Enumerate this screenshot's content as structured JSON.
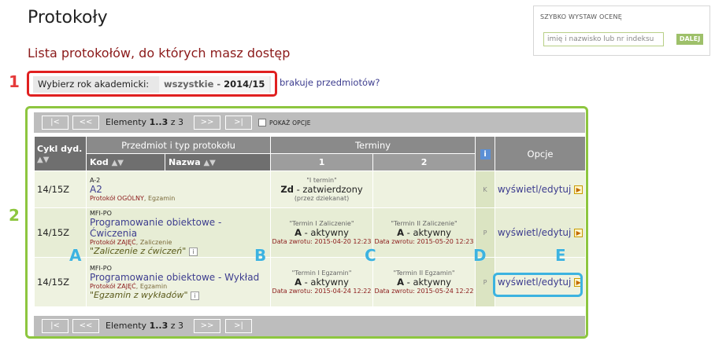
{
  "page": {
    "title": "Protokoły",
    "subtitle": "Lista protokołów, do których masz dostęp"
  },
  "quick_grade": {
    "title": "SZYBKO WYSTAW OCENĘ",
    "placeholder": "imię i nazwisko lub nr indeksu",
    "button": "DALEJ"
  },
  "year_filter": {
    "label": "Wybierz rok akademicki:",
    "value_all": "wszystkie",
    "value_sep": " - ",
    "value_year": "2014/15",
    "missing_link": "brakuje przedmiotów?"
  },
  "annotations": {
    "n1": "1",
    "n2": "2",
    "letters": [
      "A",
      "B",
      "C",
      "D",
      "E"
    ]
  },
  "pager": {
    "first": "|<",
    "prev": "<<",
    "next": ">>",
    "last": ">|",
    "text_prefix": "Elementy ",
    "range": "1..3",
    "text_suffix": " z 3",
    "show_options": "POKAŻ OPCJE"
  },
  "table": {
    "col_cycle": "Cykl dyd.",
    "col_subject": "Przedmiot i typ protokołu",
    "col_code": "Kod",
    "col_name": "Nazwa",
    "col_terms": "Terminy",
    "col_term1": "1",
    "col_term2": "2",
    "col_info": "i",
    "col_options": "Opcje",
    "rows": [
      {
        "cycle": "14/15Z",
        "code": "A-2",
        "subject": "A2",
        "protocol_kind": "Protokół OGÓLNY",
        "protocol_type": ", Egzamin",
        "note": "",
        "t1_name": "\"I termin\"",
        "t1_status_bold": "Zd",
        "t1_status": " - zatwierdzony",
        "t1_extra": "(przez dziekanat)",
        "t2_name": "",
        "t2_status_bold": "",
        "t2_status": "",
        "t2_date": "",
        "flag": "K",
        "action": "wyświetl/edytuj"
      },
      {
        "cycle": "14/15Z",
        "code": "MFI-PO",
        "subject": "Programowanie obiektowe - Ćwiczenia",
        "protocol_kind": "Protokół ZAJĘĆ",
        "protocol_type": ", Zaliczenie",
        "note": "\"Zaliczenie z ćwiczeń\"",
        "t1_name": "\"Termin I Zaliczenie\"",
        "t1_status_bold": "A",
        "t1_status": " - aktywny",
        "t1_date": "Data zwrotu: 2015-04-20 12:23",
        "t2_name": "\"Termin II Zaliczenie\"",
        "t2_status_bold": "A",
        "t2_status": " - aktywny",
        "t2_date": "Data zwrotu: 2015-05-20 12:23",
        "flag": "P",
        "action": "wyświetl/edytuj"
      },
      {
        "cycle": "14/15Z",
        "code": "MFI-PO",
        "subject": "Programowanie obiektowe - Wykład",
        "protocol_kind": "Protokół ZAJĘĆ",
        "protocol_type": ", Egzamin",
        "note": "\"Egzamin z wykładów\"",
        "t1_name": "\"Termin I Egzamin\"",
        "t1_status_bold": "A",
        "t1_status": " - aktywny",
        "t1_date": "Data zwrotu: 2015-04-24 12:22",
        "t2_name": "\"Termin II Egzamin\"",
        "t2_status_bold": "A",
        "t2_status": " - aktywny",
        "t2_date": "Data zwrotu: 2015-05-24 12:22",
        "flag": "P",
        "action": "wyświetl/edytuj"
      }
    ]
  },
  "colors": {
    "highlight_red": "#e02020",
    "highlight_green": "#8dc63f",
    "highlight_blue": "#3cb3e0",
    "link": "#3d3d8f",
    "subtitle": "#8b1a1a"
  }
}
